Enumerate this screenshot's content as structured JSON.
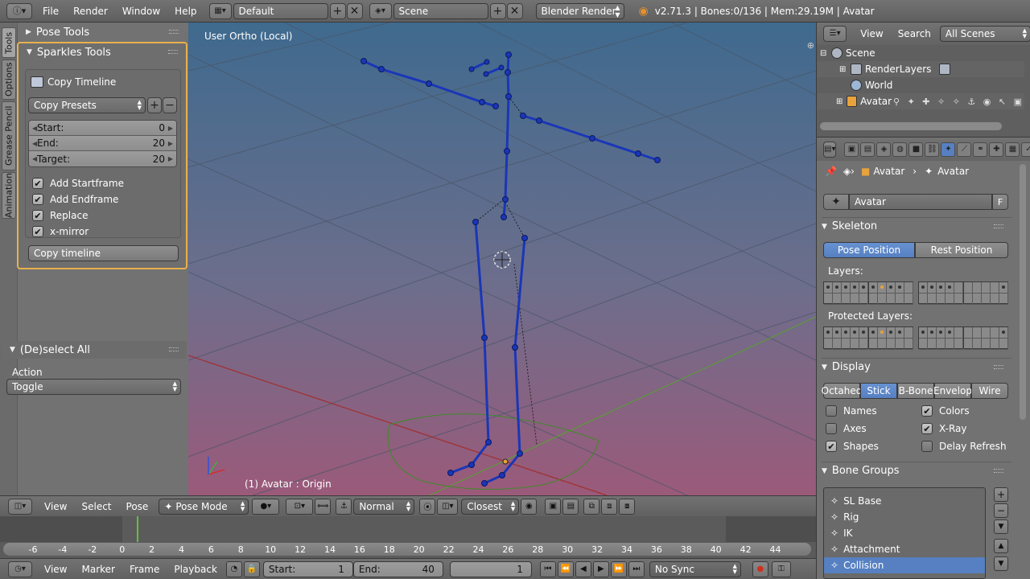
{
  "topbar": {
    "menus": [
      "File",
      "Render",
      "Window",
      "Help"
    ],
    "screen_layout": "Default",
    "scene": "Scene",
    "engine": "Blender Render",
    "status": "v2.71.3 | Bones:0/136 | Mem:29.19M | Avatar"
  },
  "left": {
    "vtabs": [
      "Tools",
      "Options",
      "Grease Pencil",
      "Animation"
    ],
    "pose_tools": "Pose Tools",
    "sparkles_title": "Sparkles Tools",
    "copy_timeline_label": "Copy Timeline",
    "copy_presets": "Copy Presets",
    "start_label": "Start:",
    "start_value": "0",
    "end_label": "End:",
    "end_value": "20",
    "target_label": "Target:",
    "target_value": "20",
    "add_startframe": "Add Startframe",
    "add_endframe": "Add Endframe",
    "replace": "Replace",
    "xmirror": "x-mirror",
    "copy_timeline_btn": "Copy timeline",
    "deselect_title": "(De)select All",
    "action_label": "Action",
    "action_value": "Toggle"
  },
  "viewport": {
    "view_name": "User Ortho (Local)",
    "object_info": "(1) Avatar : Origin"
  },
  "outliner": {
    "view": "View",
    "search": "Search",
    "filter": "All Scenes",
    "rows": [
      "Scene",
      "RenderLayers",
      "World",
      "Avatar"
    ]
  },
  "props": {
    "crumb_1": "Avatar",
    "crumb_2": "Avatar",
    "datablock": "Avatar",
    "fake_user": "F",
    "skeleton": "Skeleton",
    "pose_position": "Pose Position",
    "rest_position": "Rest Position",
    "layers_label": "Layers:",
    "protected_label": "Protected Layers:",
    "display": "Display",
    "display_modes": [
      "Octahed",
      "Stick",
      "B-Bone",
      "Envelop",
      "Wire"
    ],
    "names": "Names",
    "colors": "Colors",
    "axes": "Axes",
    "xray": "X-Ray",
    "shapes": "Shapes",
    "delay_refresh": "Delay Refresh",
    "bone_groups": "Bone Groups",
    "groups": [
      "SL Base",
      "Rig",
      "IK",
      "Attachment",
      "Collision"
    ]
  },
  "vp_header": {
    "view": "View",
    "select": "Select",
    "pose": "Pose",
    "mode": "Pose Mode",
    "pivot": "Normal",
    "snap": "Closest"
  },
  "timeline": {
    "ticks": [
      "-6",
      "-4",
      "-2",
      "0",
      "2",
      "4",
      "6",
      "8",
      "10",
      "12",
      "14",
      "16",
      "18",
      "20",
      "22",
      "24",
      "26",
      "28",
      "30",
      "32",
      "34",
      "36",
      "38",
      "40",
      "42",
      "44"
    ]
  },
  "tl_bottom": {
    "view": "View",
    "marker": "Marker",
    "frame": "Frame",
    "playback": "Playback",
    "start_label": "Start:",
    "start_value": "1",
    "end_label": "End:",
    "end_value": "40",
    "current": "1",
    "sync": "No Sync"
  },
  "colors": {
    "accent": "#5680c2",
    "highlight": "#e8b04e",
    "bone": "#1f3fbf"
  }
}
